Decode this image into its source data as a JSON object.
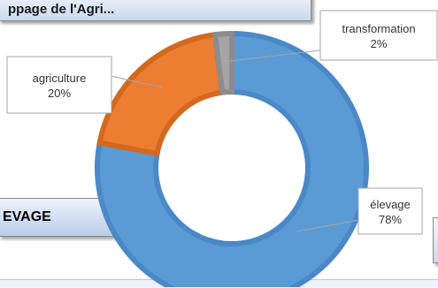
{
  "header": {
    "title_fragment": "ppage de l'Agri..."
  },
  "section": {
    "label": "EVAGE"
  },
  "colors": {
    "elevage": "#5b9bd5",
    "agriculture": "#ed7d31",
    "transformation": "#a5a5a5"
  },
  "chart_data": {
    "type": "pie",
    "donut": true,
    "slices": [
      {
        "category": "élevage",
        "value": 78,
        "label": "78%",
        "color": "#5b9bd5",
        "stroke": "#4a88c7"
      },
      {
        "category": "agriculture",
        "value": 20,
        "label": "20%",
        "color": "#ed7d31",
        "stroke": "#d2691e"
      },
      {
        "category": "transformation",
        "value": 2,
        "label": "2%",
        "color": "#a5a5a5",
        "stroke": "#8c8c8c"
      }
    ],
    "legend": "none"
  }
}
